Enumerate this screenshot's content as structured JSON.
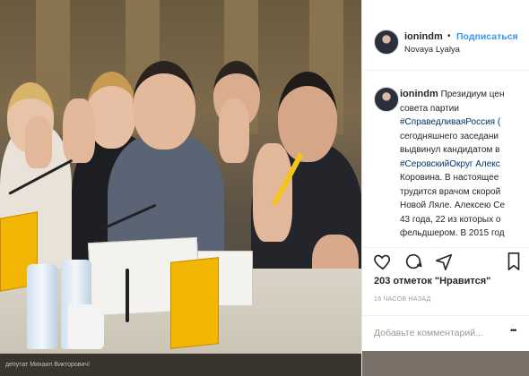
{
  "post": {
    "username": "ionindm",
    "follow_label": "Подписаться",
    "separator": "•",
    "location": "Novaya Lyalya",
    "caption_lines": [
      "Президиум цен",
      "совета партии",
      "#СправедливаяРоссия (",
      "сегодняшнего заседани",
      "выдвинул кандидатом в",
      "#СеровскийОкруг Алекс",
      "Коровина. В настоящее",
      "трудится врачом скорой",
      "Новой Ляле. Алексею Се",
      "43 года, 22 из которых о",
      "фельдшером. В 2015 год"
    ],
    "likes": "203 отметок \"Нравится\"",
    "time": "16 ЧАСОВ НАЗАД",
    "comment_placeholder": "Добавьте комментарий...",
    "more_label": "•••"
  },
  "photo": {
    "bottom_caption": "депутат Михаил Викторович!"
  },
  "colors": {
    "accent": "#3897f0",
    "hashtag": "#003569",
    "party_yellow": "#f2b705"
  },
  "icons": [
    "avatar",
    "heart-icon",
    "comment-icon",
    "share-icon",
    "bookmark-icon"
  ]
}
